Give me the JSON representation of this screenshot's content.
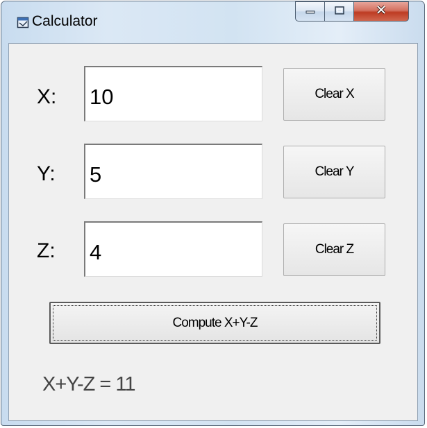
{
  "window": {
    "title": "Calculator",
    "icons": {
      "app": "app-window-icon",
      "minimize": "minimize-icon",
      "maximize": "maximize-icon",
      "close": "close-icon"
    },
    "colors": {
      "client_bg": "#f0f0f0",
      "close_button": "#c8442b"
    }
  },
  "form": {
    "rows": [
      {
        "label": "X:",
        "value": "10",
        "clear_label": "Clear X"
      },
      {
        "label": "Y:",
        "value": "5",
        "clear_label": "Clear Y"
      },
      {
        "label": "Z:",
        "value": "4",
        "clear_label": "Clear Z"
      }
    ],
    "compute_label": "Compute X+Y-Z",
    "result_label": "X+Y-Z =",
    "result_value": "11"
  }
}
